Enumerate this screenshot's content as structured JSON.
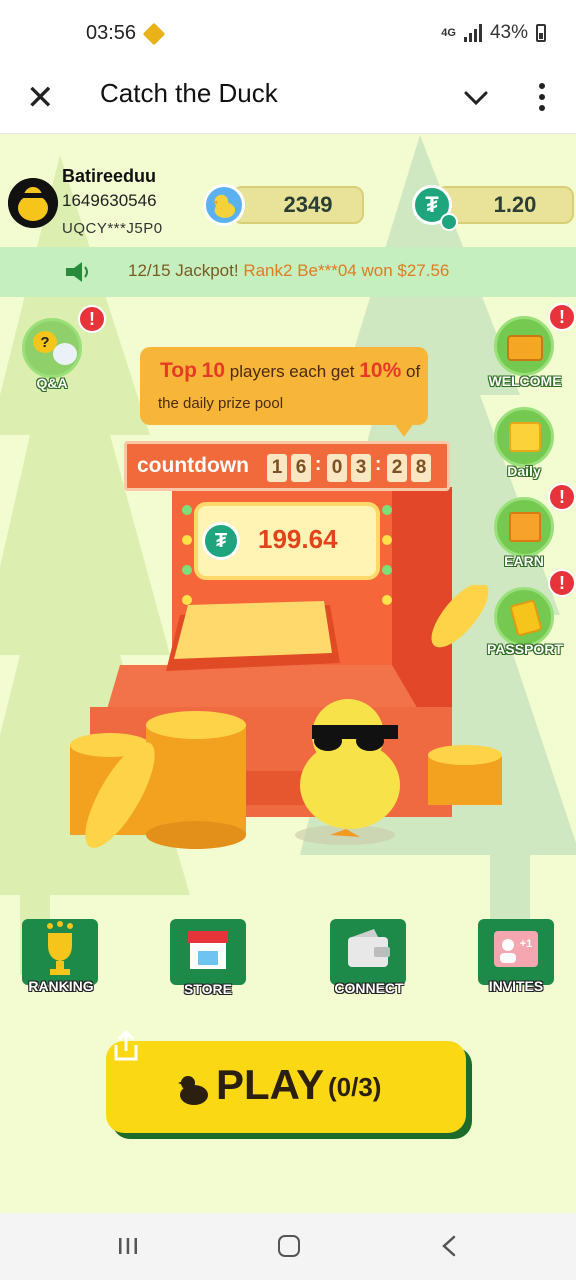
{
  "status_bar": {
    "time": "03:56",
    "network": "4G",
    "battery": "43%"
  },
  "app_bar": {
    "title": "Catch the Duck"
  },
  "profile": {
    "name": "Batireeduu",
    "id": "1649630546",
    "wallet": "UQCY***J5P0"
  },
  "balances": {
    "duck_coins": "2349",
    "usdt": "1.20"
  },
  "ticker": {
    "prefix": "12/15 Jackpot!",
    "rank": "Rank2",
    "user": "Be***04 won",
    "amount": "$27.56"
  },
  "tip": {
    "prefix": "Top",
    "top_count": "10",
    "mid": "players each get",
    "percent": "10%",
    "suffix": "of",
    "line2": "the daily prize pool"
  },
  "countdown": {
    "label": "countdown",
    "digits": [
      "1",
      "6",
      "0",
      "3",
      "2",
      "8"
    ]
  },
  "prize_pool": "199.64",
  "side_menu": {
    "qa": "Q&A",
    "welcome": "WELCOME",
    "daily": "Daily",
    "earn": "EARN",
    "passport": "PASSPORT"
  },
  "alert_symbol": "!",
  "bottom_menu": {
    "ranking": "RANKING",
    "store": "STORE",
    "connect": "CONNECT",
    "invites": "INVITES"
  },
  "play": {
    "label": "PLAY",
    "count": "(0/3)"
  },
  "colors": {
    "accent_green": "#1e8a4a",
    "play_yellow": "#fbd814",
    "machine_orange": "#f5673a",
    "usdt_green": "#1ea57e"
  }
}
